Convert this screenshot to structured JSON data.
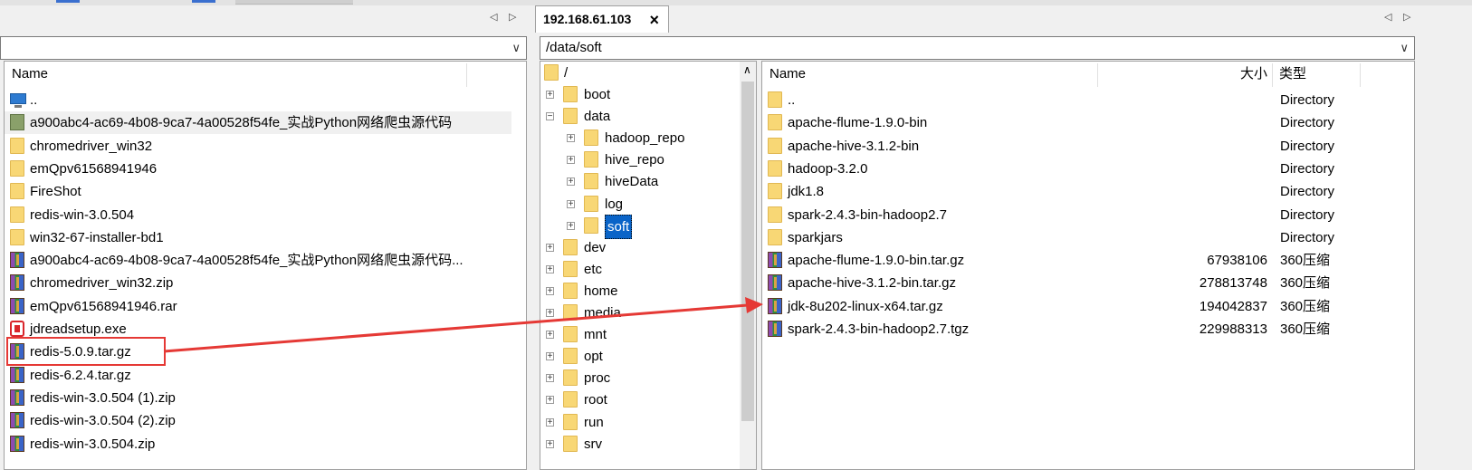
{
  "left_pane": {
    "path_value": "",
    "column_name": "Name",
    "items": [
      {
        "name": "..",
        "icon": "computer-icon"
      },
      {
        "name": "a900abc4-ac69-4b08-9ca7-4a00528f54fe_实战Python网络爬虫源代码",
        "icon": "image-folder-icon"
      },
      {
        "name": "chromedriver_win32",
        "icon": "folder-icon"
      },
      {
        "name": "emQpv61568941946",
        "icon": "folder-icon"
      },
      {
        "name": "FireShot",
        "icon": "folder-icon"
      },
      {
        "name": "redis-win-3.0.504",
        "icon": "folder-icon"
      },
      {
        "name": "win32-67-installer-bd1",
        "icon": "folder-icon"
      },
      {
        "name": "a900abc4-ac69-4b08-9ca7-4a00528f54fe_实战Python网络爬虫源代码...",
        "icon": "archive-icon"
      },
      {
        "name": "chromedriver_win32.zip",
        "icon": "archive-icon"
      },
      {
        "name": "emQpv61568941946.rar",
        "icon": "archive-icon"
      },
      {
        "name": "jdreadsetup.exe",
        "icon": "exe-icon"
      },
      {
        "name": "redis-5.0.9.tar.gz",
        "icon": "archive-icon"
      },
      {
        "name": "redis-6.2.4.tar.gz",
        "icon": "archive-icon"
      },
      {
        "name": "redis-win-3.0.504 (1).zip",
        "icon": "archive-icon"
      },
      {
        "name": "redis-win-3.0.504 (2).zip",
        "icon": "archive-icon"
      },
      {
        "name": "redis-win-3.0.504.zip",
        "icon": "archive-icon"
      }
    ]
  },
  "remote_tab": {
    "label": "192.168.61.103",
    "close": "×"
  },
  "remote_path": "/data/soft",
  "tree": {
    "root": "/",
    "items": [
      {
        "name": "boot",
        "expander": "+"
      },
      {
        "name": "data",
        "expander": "−"
      },
      {
        "name": "hadoop_repo",
        "expander": "+"
      },
      {
        "name": "hive_repo",
        "expander": "+"
      },
      {
        "name": "hiveData",
        "expander": "+"
      },
      {
        "name": "log",
        "expander": "+"
      },
      {
        "name": "soft",
        "expander": "+"
      },
      {
        "name": "dev",
        "expander": "+"
      },
      {
        "name": "etc",
        "expander": "+"
      },
      {
        "name": "home",
        "expander": "+"
      },
      {
        "name": "media",
        "expander": "+"
      },
      {
        "name": "mnt",
        "expander": "+"
      },
      {
        "name": "opt",
        "expander": "+"
      },
      {
        "name": "proc",
        "expander": "+"
      },
      {
        "name": "root",
        "expander": "+"
      },
      {
        "name": "run",
        "expander": "+"
      },
      {
        "name": "srv",
        "expander": "+"
      }
    ]
  },
  "right_pane": {
    "columns": {
      "name": "Name",
      "size": "大小",
      "type": "类型"
    },
    "items": [
      {
        "name": "..",
        "size": "",
        "type": "Directory",
        "icon": "folder-icon"
      },
      {
        "name": "apache-flume-1.9.0-bin",
        "size": "",
        "type": "Directory",
        "icon": "folder-icon"
      },
      {
        "name": "apache-hive-3.1.2-bin",
        "size": "",
        "type": "Directory",
        "icon": "folder-icon"
      },
      {
        "name": "hadoop-3.2.0",
        "size": "",
        "type": "Directory",
        "icon": "folder-icon"
      },
      {
        "name": "jdk1.8",
        "size": "",
        "type": "Directory",
        "icon": "folder-icon"
      },
      {
        "name": "spark-2.4.3-bin-hadoop2.7",
        "size": "",
        "type": "Directory",
        "icon": "folder-icon"
      },
      {
        "name": "sparkjars",
        "size": "",
        "type": "Directory",
        "icon": "folder-icon"
      },
      {
        "name": "apache-flume-1.9.0-bin.tar.gz",
        "size": "67938106",
        "type": "360压缩",
        "icon": "archive-icon"
      },
      {
        "name": "apache-hive-3.1.2-bin.tar.gz",
        "size": "278813748",
        "type": "360压缩",
        "icon": "archive-icon"
      },
      {
        "name": "jdk-8u202-linux-x64.tar.gz",
        "size": "194042837",
        "type": "360压缩",
        "icon": "archive-icon"
      },
      {
        "name": "spark-2.4.3-bin-hadoop2.7.tgz",
        "size": "229988313",
        "type": "360压缩",
        "icon": "archive-icon"
      }
    ]
  },
  "nav": {
    "back": "◁",
    "forward": "▷",
    "dropdown": "∨",
    "scroll_up": "∧"
  },
  "annotation": {
    "color": "#e53935"
  }
}
